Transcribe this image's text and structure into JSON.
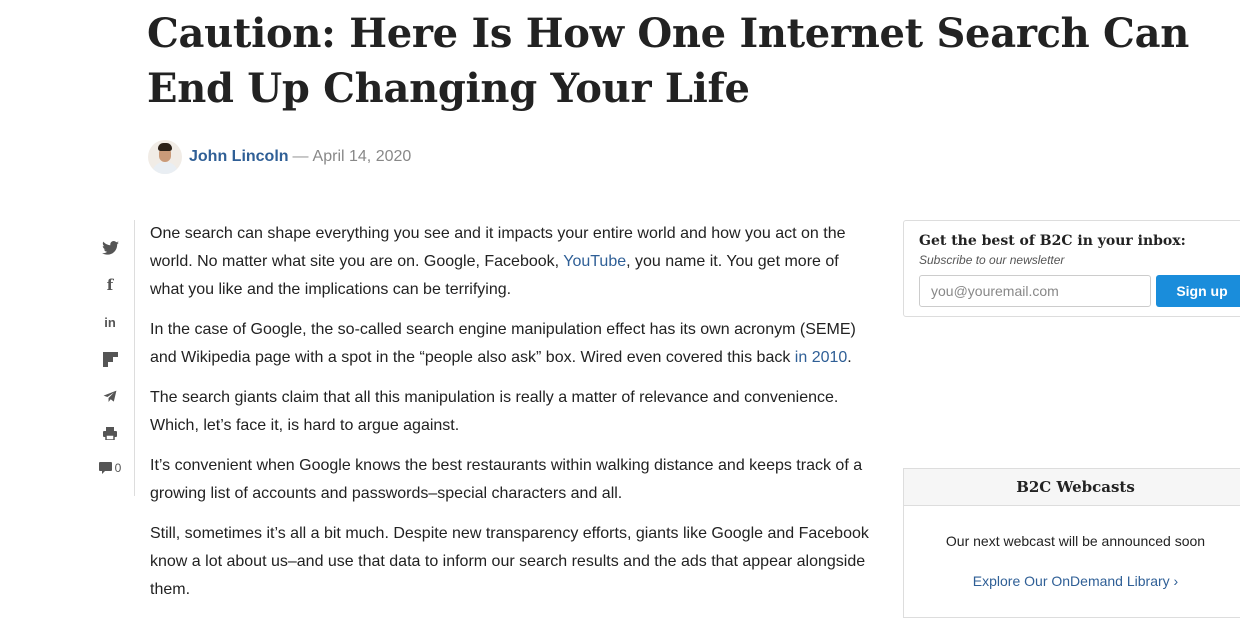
{
  "article": {
    "title": "Caution: Here Is How One Internet Search Can End Up Changing Your Life",
    "author": "John Lincoln",
    "separator": "—",
    "date": "April 14, 2020",
    "paragraphs": [
      {
        "before": "One search can shape everything you see and it impacts your entire world and how you act on the world. No matter what site you are on. Google, Facebook, ",
        "link": "YouTube",
        "after": ", you name it. You get more of what you like and the implications can be terrifying."
      },
      {
        "before": "In the case of Google, the so-called search engine manipulation effect has its own acronym (SEME) and Wikipedia page with a spot in the “people also ask” box. Wired even covered this back ",
        "link": "in 2010",
        "after": "."
      },
      {
        "text": "The search giants claim that all this manipulation is really a matter of relevance and convenience. Which, let’s face it, is hard to argue against."
      },
      {
        "text": "It’s convenient when Google knows the best restaurants within walking distance and keeps track of a growing list of accounts and passwords–special characters and all."
      },
      {
        "text": "Still, sometimes it’s all a bit much. Despite new transparency efforts, giants like Google and Facebook know a lot about us–and use that data to inform our search results and the ads that appear alongside them."
      }
    ]
  },
  "share": {
    "icons": [
      "twitter-icon",
      "facebook-icon",
      "linkedin-icon",
      "flipboard-icon",
      "telegram-icon",
      "print-icon",
      "comment-icon"
    ],
    "comment_count": "0"
  },
  "newsletter": {
    "heading": "Get the best of B2C in your inbox:",
    "subheading": "Subscribe to our newsletter",
    "placeholder": "you@youremail.com",
    "button": "Sign up",
    "button_color": "#1a8ddb"
  },
  "webcasts": {
    "heading": "B2C Webcasts",
    "message": "Our next webcast will be announced soon",
    "link": "Explore Our OnDemand Library ›"
  },
  "colors": {
    "link": "#2f5f96",
    "text": "#222222"
  }
}
